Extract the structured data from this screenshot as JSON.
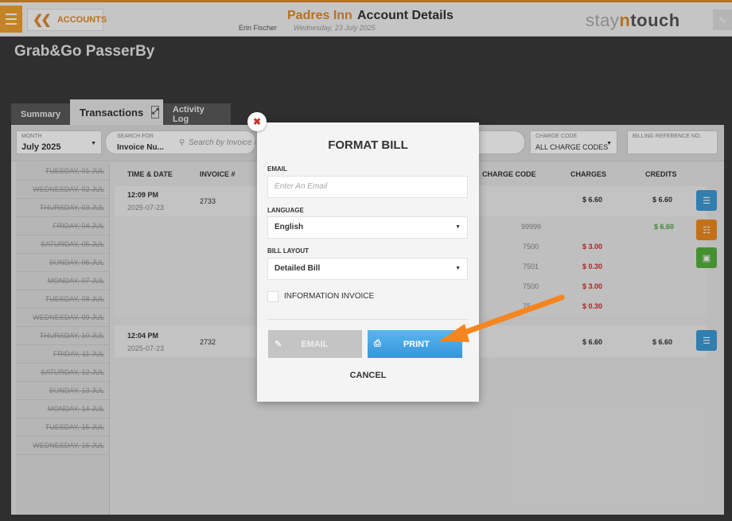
{
  "topbar": {
    "back_label": "ACCOUNTS",
    "hotel": "Padres Inn",
    "page_title": "Account Details",
    "user": "Erin Fischer",
    "date": "Wednesday, 23 July 2025",
    "brand_pre": "stay",
    "brand_n": "n",
    "brand_post": "touch"
  },
  "account": {
    "name": "Grab&Go PasserBy"
  },
  "tabs": {
    "summary": "Summary",
    "transactions": "Transactions",
    "activity_log": "Activity Log"
  },
  "filters": {
    "month_label": "MONTH",
    "month_value": "July 2025",
    "search_for_label": "SEARCH FOR",
    "search_for_value": "Invoice Nu...",
    "search_placeholder": "Search by Invoice N",
    "charge_code_label": "CHARGE CODE",
    "charge_code_value": "ALL CHARGE CODES",
    "billing_ref_label": "BILLING REFERENCE NO."
  },
  "days": [
    "TUESDAY, 01 JUL",
    "WEDNESDAY, 02 JUL",
    "THURSDAY, 03 JUL",
    "FRIDAY, 04 JUL",
    "SATURDAY, 05 JUL",
    "SUNDAY, 06 JUL",
    "MONDAY, 07 JUL",
    "TUESDAY, 08 JUL",
    "WEDNESDAY, 09 JUL",
    "THURSDAY, 10 JUL",
    "FRIDAY, 11 JUL",
    "SATURDAY, 12 JUL",
    "SUNDAY, 13 JUL",
    "MONDAY, 14 JUL",
    "TUESDAY, 15 JUL",
    "WEDNESDAY, 16 JUL"
  ],
  "table": {
    "headers": {
      "time_date": "TIME & DATE",
      "invoice": "INVOICE #",
      "charge_code": "CHARGE CODE",
      "charges": "CHARGES",
      "credits": "CREDITS"
    },
    "rows": [
      {
        "time": "12:09 PM",
        "date": "2025-07-23",
        "invoice": "2733",
        "charges": "$ 6.60",
        "credits": "$ 6.60",
        "lines": [
          {
            "code": "99999",
            "charge": "",
            "credit": "$ 6.60"
          },
          {
            "code": "7500",
            "charge": "$ 3.00",
            "credit": ""
          },
          {
            "code": "7501",
            "charge": "$ 0.30",
            "credit": ""
          },
          {
            "code": "7500",
            "charge": "$ 3.00",
            "credit": ""
          },
          {
            "code": "75",
            "charge": "$ 0.30",
            "credit": ""
          }
        ]
      },
      {
        "time": "12:04 PM",
        "date": "2025-07-23",
        "invoice": "2732",
        "charges": "$ 6.60",
        "credits": "$ 6.60"
      }
    ]
  },
  "modal": {
    "title": "FORMAT BILL",
    "email_label": "EMAIL",
    "email_placeholder": "Enter An Email",
    "language_label": "LANGUAGE",
    "language_value": "English",
    "layout_label": "BILL LAYOUT",
    "layout_value": "Detailed Bill",
    "info_invoice_label": "INFORMATION INVOICE",
    "email_button": "EMAIL",
    "print_button": "PRINT",
    "cancel_button": "CANCEL"
  },
  "colors": {
    "accent": "#e08a2a",
    "print_blue": "#3a95d8",
    "charge_red": "#d0302a",
    "credit_green": "#4aa840",
    "annotation_arrow": "#f5861f"
  }
}
